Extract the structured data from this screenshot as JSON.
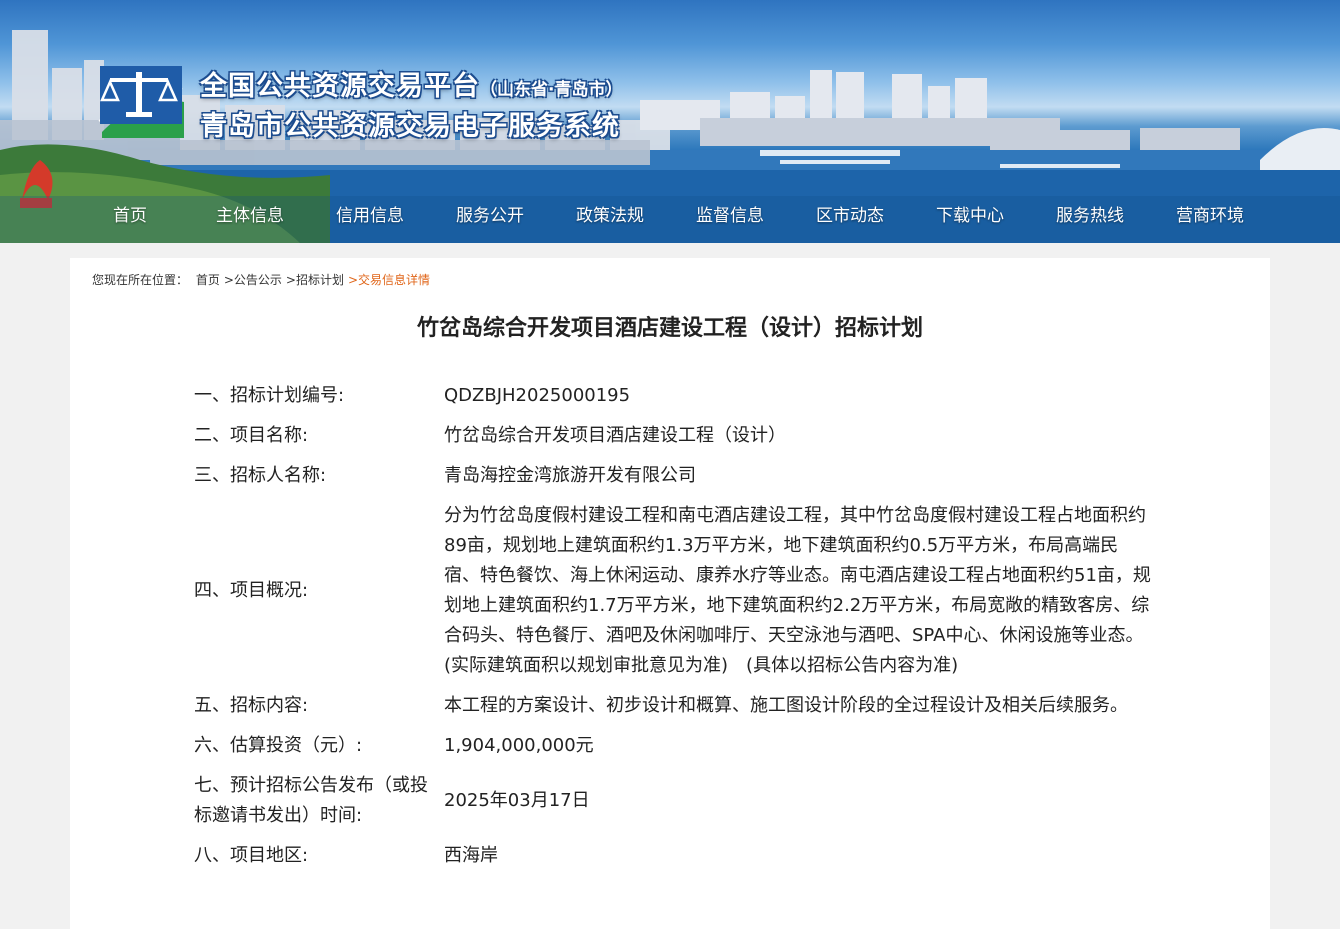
{
  "header": {
    "title_main": "全国公共资源交易平台",
    "title_region": "（山东省·青岛市）",
    "title_sub": "青岛市公共资源交易电子服务系统"
  },
  "nav": {
    "items": [
      {
        "label": "首页"
      },
      {
        "label": "主体信息"
      },
      {
        "label": "信用信息"
      },
      {
        "label": "服务公开"
      },
      {
        "label": "政策法规"
      },
      {
        "label": "监督信息"
      },
      {
        "label": "区市动态"
      },
      {
        "label": "下载中心"
      },
      {
        "label": "服务热线"
      },
      {
        "label": "营商环境"
      }
    ]
  },
  "breadcrumb": {
    "prefix": "您现在所在位置：",
    "items": [
      "首页",
      ">公告公示",
      ">招标计划"
    ],
    "current": ">交易信息详情"
  },
  "page": {
    "title": "竹岔岛综合开发项目酒店建设工程（设计）招标计划"
  },
  "details": [
    {
      "label": "一、招标计划编号:",
      "value": "QDZBJH2025000195"
    },
    {
      "label": "二、项目名称:",
      "value": "竹岔岛综合开发项目酒店建设工程（设计）"
    },
    {
      "label": "三、招标人名称:",
      "value": "青岛海控金湾旅游开发有限公司"
    },
    {
      "label": "四、项目概况:",
      "value": "分为竹岔岛度假村建设工程和南屯酒店建设工程，其中竹岔岛度假村建设工程占地面积约89亩，规划地上建筑面积约1.3万平方米，地下建筑面积约0.5万平方米，布局高端民宿、特色餐饮、海上休闲运动、康养水疗等业态。南屯酒店建设工程占地面积约51亩，规划地上建筑面积约1.7万平方米，地下建筑面积约2.2万平方米，布局宽敞的精致客房、综合码头、特色餐厅、酒吧及休闲咖啡厅、天空泳池与酒吧、SPA中心、休闲设施等业态。(实际建筑面积以规划审批意见为准)　(具体以招标公告内容为准)"
    },
    {
      "label": "五、招标内容:",
      "value": "本工程的方案设计、初步设计和概算、施工图设计阶段的全过程设计及相关后续服务。"
    },
    {
      "label": "六、估算投资（元）:",
      "value": "1,904,000,000元"
    },
    {
      "label": "七、预计招标公告发布（或投标邀请书发出）时间:",
      "value": "2025年03月17日"
    },
    {
      "label": "八、项目地区:",
      "value": "西海岸"
    }
  ],
  "colors": {
    "nav_text": "#ffffff",
    "breadcrumb_current": "#e0661a",
    "card_bg": "#ffffff",
    "page_bg": "#f1f1f1"
  }
}
